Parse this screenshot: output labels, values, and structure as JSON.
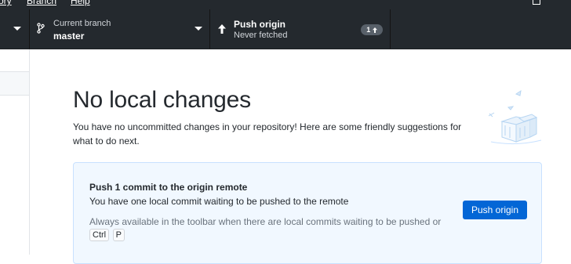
{
  "menubar": {
    "items": [
      "ory",
      "Branch",
      "Help"
    ]
  },
  "toolbar": {
    "branch": {
      "label": "Current branch",
      "value": "master"
    },
    "push": {
      "label": "Push origin",
      "status": "Never fetched",
      "badge_count": "1",
      "badge_icon": "arrow-up-icon"
    }
  },
  "main": {
    "title": "No local changes",
    "subtitle": "You have no uncommitted changes in your repository! Here are some friendly suggestions for what to do next.",
    "card": {
      "title": "Push 1 commit to the origin remote",
      "description": "You have one local commit waiting to be pushed to the remote",
      "hint": "Always available in the toolbar when there are local commits waiting to be pushed or",
      "shortcut_keys": [
        "Ctrl",
        "P"
      ],
      "button_label": "Push origin"
    }
  },
  "colors": {
    "toolbar_bg": "#24292e",
    "accent": "#0366d6",
    "card_bg": "#f1f8ff",
    "card_border": "#c8e1ff"
  }
}
